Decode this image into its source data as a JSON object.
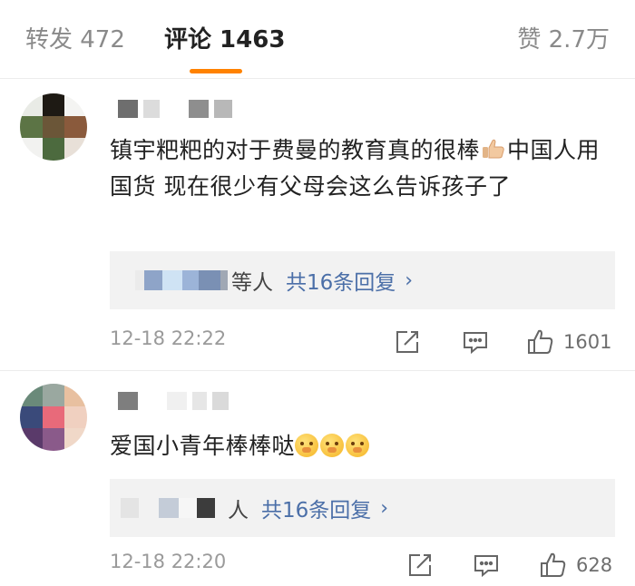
{
  "tabs": {
    "forward_label": "转发 472",
    "comments_label": "评论 1463",
    "likes_label": "赞 2.7万"
  },
  "colors": {
    "accent": "#ff8200",
    "link": "#4b6fa8",
    "reply_bg": "#f2f2f2",
    "meta_text": "#9a9a9a"
  },
  "comments": [
    {
      "text": "镇宇粑粑的对于费曼的教育真的很棒",
      "text_after_emoji": "中国人用国货 现在很少有父母会这么告诉孩子了",
      "emoji": "thumbs-up-emoji",
      "replies": {
        "who_suffix": "等人",
        "count_text": "共16条回复",
        "chevron": "›"
      },
      "time": "12-18 22:22",
      "like_count": "1601"
    },
    {
      "text": "爱国小青年棒棒哒",
      "emoji": "face-emoji",
      "replies": {
        "who_suffix": "人",
        "count_text": "共16条回复",
        "chevron": "›"
      },
      "time": "12-18 22:20",
      "like_count": "628"
    }
  ]
}
